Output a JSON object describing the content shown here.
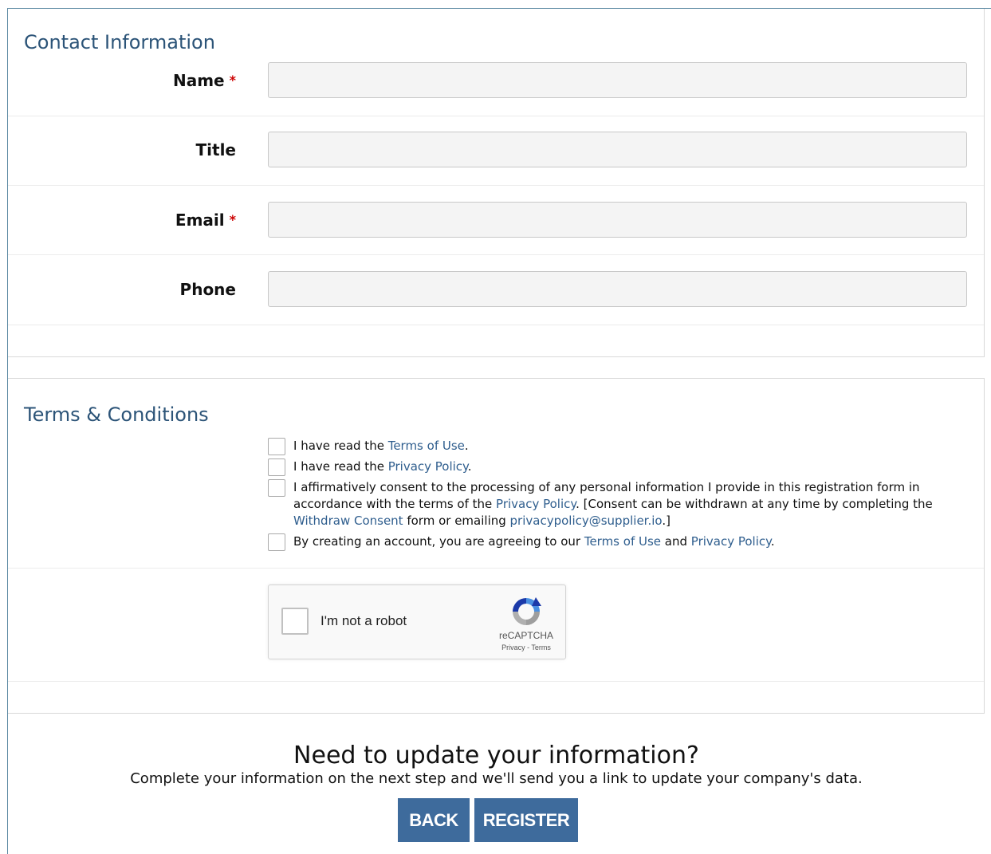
{
  "contact": {
    "title": "Contact Information",
    "fields": [
      {
        "label": "Name",
        "required": true,
        "value": ""
      },
      {
        "label": "Title",
        "required": false,
        "value": ""
      },
      {
        "label": "Email",
        "required": true,
        "value": ""
      },
      {
        "label": "Phone",
        "required": false,
        "value": ""
      }
    ],
    "required_marker": "*"
  },
  "terms": {
    "title": "Terms & Conditions",
    "items": [
      {
        "checked": false,
        "pre": "I have read the ",
        "link1": "Terms of Use",
        "post": "."
      },
      {
        "checked": false,
        "pre": "I have read the ",
        "link1": "Privacy Policy",
        "post": "."
      },
      {
        "checked": false,
        "pre": "I affirmatively consent to the processing of any personal information I provide in this registration form in accordance with the terms of the ",
        "link1": "Privacy Policy",
        "mid": ". [Consent can be withdrawn at any time by completing the ",
        "link2": "Withdraw Consent",
        "mid2": " form or emailing ",
        "link3": "privacypolicy@supplier.io",
        "post": ".]"
      },
      {
        "checked": false,
        "pre": "By creating an account, you are agreeing to our ",
        "link1": "Terms of Use",
        "mid": " and ",
        "link2": "Privacy Policy",
        "post": "."
      }
    ]
  },
  "recaptcha": {
    "label": "I'm not a robot",
    "brand": "reCAPTCHA",
    "links": "Privacy - Terms",
    "checked": false
  },
  "footer": {
    "title": "Need to update your information?",
    "subtitle": "Complete your information on the next step and we'll send you a link to update your company's data.",
    "back_label": "BACK",
    "register_label": "REGISTER"
  },
  "colors": {
    "section_title": "#2c5478",
    "link": "#2f5e8e",
    "button": "#3e6b9c",
    "required": "#cc0000"
  }
}
